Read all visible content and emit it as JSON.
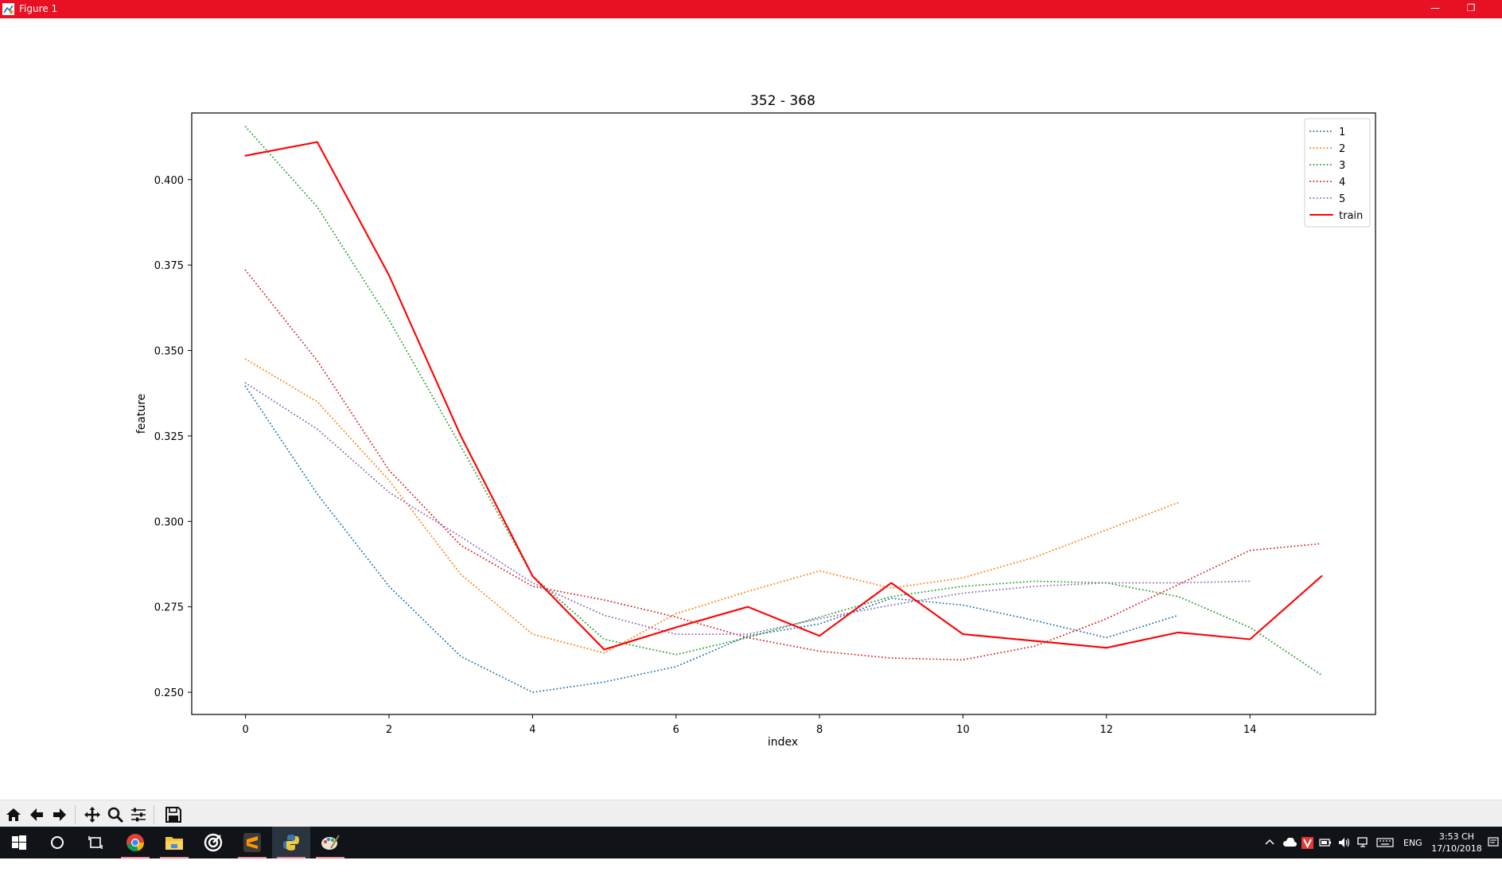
{
  "window": {
    "title": "Figure 1",
    "minimize_glyph": "—",
    "restore_glyph": "❐"
  },
  "chart_data": {
    "type": "line",
    "title": "352 - 368",
    "xlabel": "index",
    "ylabel": "feature",
    "xlim": [
      -0.75,
      15.75
    ],
    "ylim": [
      0.2435,
      0.4195
    ],
    "xticks": [
      0,
      2,
      4,
      6,
      8,
      10,
      12,
      14
    ],
    "yticks": [
      0.25,
      0.275,
      0.3,
      0.325,
      0.35,
      0.375,
      0.4
    ],
    "ytick_labels": [
      "0.250",
      "0.275",
      "0.300",
      "0.325",
      "0.350",
      "0.375",
      "0.400"
    ],
    "grid": false,
    "legend_position": "top-right",
    "series": [
      {
        "name": "1",
        "color": "#1f77b4",
        "style": "dotted",
        "x": [
          0,
          1,
          2,
          3,
          4,
          5,
          6,
          7,
          8,
          9,
          10,
          11,
          12,
          13
        ],
        "values": [
          0.3395,
          0.308,
          0.281,
          0.2605,
          0.25,
          0.253,
          0.2575,
          0.2665,
          0.27,
          0.2775,
          0.2755,
          0.271,
          0.266,
          0.2725
        ]
      },
      {
        "name": "2",
        "color": "#ff7f0e",
        "style": "dotted",
        "x": [
          0,
          1,
          2,
          3,
          4,
          5,
          6,
          7,
          8,
          9,
          10,
          11,
          12,
          13
        ],
        "values": [
          0.3475,
          0.335,
          0.312,
          0.2845,
          0.267,
          0.2615,
          0.273,
          0.2795,
          0.2855,
          0.2805,
          0.2835,
          0.2895,
          0.2975,
          0.3055
        ]
      },
      {
        "name": "3",
        "color": "#2ca02c",
        "style": "dotted",
        "x": [
          0,
          1,
          2,
          3,
          4,
          5,
          6,
          7,
          8,
          9,
          10,
          11,
          12,
          13,
          14,
          15
        ],
        "values": [
          0.4155,
          0.392,
          0.359,
          0.322,
          0.284,
          0.2655,
          0.261,
          0.266,
          0.272,
          0.278,
          0.281,
          0.2825,
          0.282,
          0.278,
          0.269,
          0.255
        ]
      },
      {
        "name": "4",
        "color": "#d62728",
        "style": "dotted",
        "x": [
          0,
          1,
          2,
          3,
          4,
          5,
          6,
          7,
          8,
          9,
          10,
          11,
          12,
          13,
          14,
          15
        ],
        "values": [
          0.3735,
          0.347,
          0.315,
          0.293,
          0.281,
          0.277,
          0.272,
          0.266,
          0.262,
          0.26,
          0.2595,
          0.2635,
          0.2715,
          0.2815,
          0.2915,
          0.2935
        ]
      },
      {
        "name": "5",
        "color": "#9467bd",
        "style": "dotted",
        "x": [
          0,
          1,
          2,
          3,
          4,
          5,
          6,
          7,
          8,
          9,
          10,
          11,
          12,
          13,
          14
        ],
        "values": [
          0.3405,
          0.327,
          0.3085,
          0.2955,
          0.282,
          0.2725,
          0.267,
          0.267,
          0.2715,
          0.2755,
          0.279,
          0.281,
          0.282,
          0.282,
          0.2825
        ]
      },
      {
        "name": "train",
        "color": "#ff0000",
        "style": "solid",
        "x": [
          0,
          1,
          2,
          3,
          4,
          5,
          6,
          7,
          8,
          9,
          10,
          11,
          12,
          13,
          14,
          15
        ],
        "values": [
          0.407,
          0.411,
          0.372,
          0.325,
          0.284,
          0.2625,
          0.269,
          0.275,
          0.2665,
          0.282,
          0.267,
          0.265,
          0.263,
          0.2675,
          0.2655,
          0.284
        ]
      }
    ]
  },
  "toolbar": {
    "buttons": [
      {
        "name": "home-button",
        "icon": "home-icon"
      },
      {
        "name": "back-button",
        "icon": "arrow-left-icon"
      },
      {
        "name": "forward-button",
        "icon": "arrow-right-icon"
      },
      {
        "name": "pan-button",
        "icon": "move-icon"
      },
      {
        "name": "zoom-button",
        "icon": "magnifier-icon"
      },
      {
        "name": "configure-subplots-button",
        "icon": "sliders-icon"
      },
      {
        "name": "save-button",
        "icon": "floppy-disk-icon"
      }
    ]
  },
  "taskbar": {
    "time": "3:53 CH",
    "date": "17/10/2018",
    "language": "ENG",
    "apps": [
      "windows-start-icon",
      "cortana-icon",
      "task-view-icon",
      "chrome-icon",
      "file-explorer-icon",
      "target-app-icon",
      "sublime-text-icon",
      "python-icon",
      "paint-icon"
    ]
  }
}
